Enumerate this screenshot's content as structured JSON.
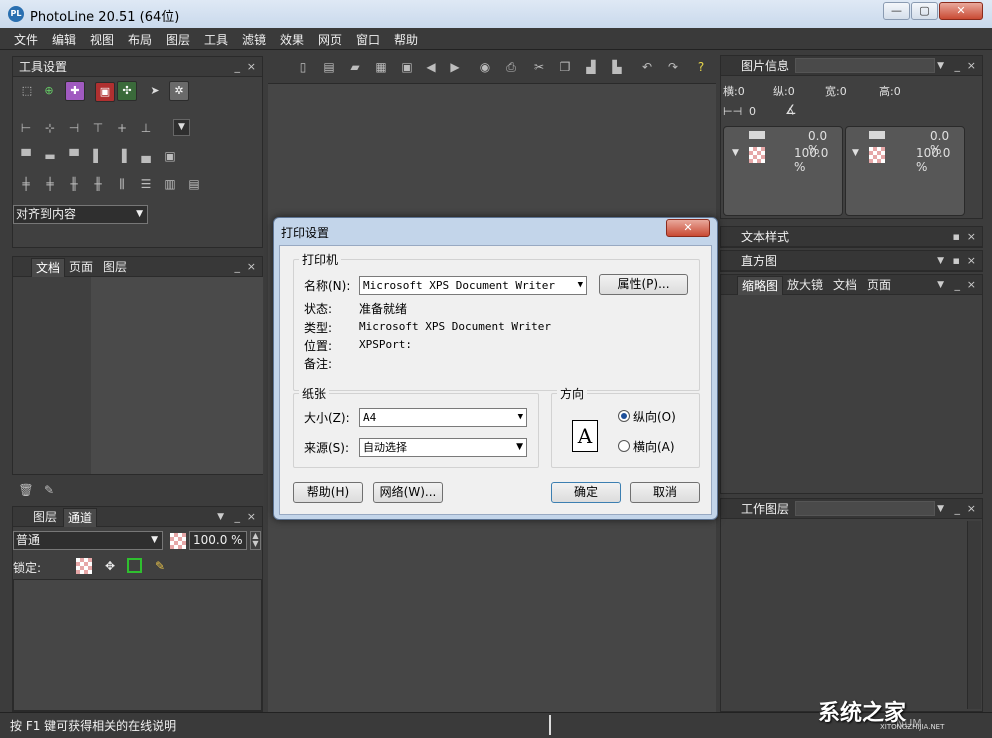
{
  "window": {
    "title": "PhotoLine 20.51 (64位)",
    "icon_text": "PL",
    "minimize": "—",
    "restore": "▢",
    "close": "✕"
  },
  "menu": [
    "文件",
    "编辑",
    "视图",
    "布局",
    "图层",
    "工具",
    "滤镜",
    "效果",
    "网页",
    "窗口",
    "帮助"
  ],
  "tool_settings": {
    "title": "工具设置",
    "align_dropdown": "对齐到内容",
    "min": "_",
    "close": "×"
  },
  "doc_panel": {
    "tabs": [
      "文档",
      "页面",
      "图层"
    ]
  },
  "layers_panel": {
    "tabs": [
      "图层",
      "通道"
    ],
    "blend_mode": "普通",
    "opacity": "100.0 %",
    "lock_label": "锁定:"
  },
  "image_info": {
    "title": "图片信息",
    "h": "横:0",
    "v": "纵:0",
    "w": "宽:0",
    "hgt": "高:0",
    "dist": "0",
    "left_top_pct": "0.0 %",
    "left_bot_pct": "100.0 %",
    "right_top_pct": "0.0 %",
    "right_bot_pct": "100.0 %"
  },
  "right_panels": {
    "text_style": "文本样式",
    "histogram": "直方图",
    "tabs": [
      "缩略图",
      "放大镜",
      "文档",
      "页面"
    ],
    "work_layers": "工作图层"
  },
  "status": {
    "hint": "按 F1 键可获得相关的在线说明",
    "num": "NUM"
  },
  "watermark": {
    "text": "系统之家",
    "sub": "XITONGZHIJIA.NET"
  },
  "dialog": {
    "title": "打印设置",
    "close": "✕",
    "printer_group": "打印机",
    "name_label": "名称(N):",
    "printer_name": "Microsoft XPS Document Writer",
    "properties_button": "属性(P)...",
    "status_label": "状态:",
    "status_value": "准备就绪",
    "type_label": "类型:",
    "type_value": "Microsoft XPS Document Writer",
    "location_label": "位置:",
    "location_value": "XPSPort:",
    "comment_label": "备注:",
    "paper_group": "纸张",
    "size_label": "大小(Z):",
    "size_value": "A4",
    "source_label": "来源(S):",
    "source_value": "自动选择",
    "orientation_group": "方向",
    "portrait_label": "纵向(O)",
    "landscape_label": "横向(A)",
    "orientation_icon": "A",
    "help_button": "帮助(H)",
    "network_button": "网络(W)...",
    "ok_button": "确定",
    "cancel_button": "取消"
  }
}
